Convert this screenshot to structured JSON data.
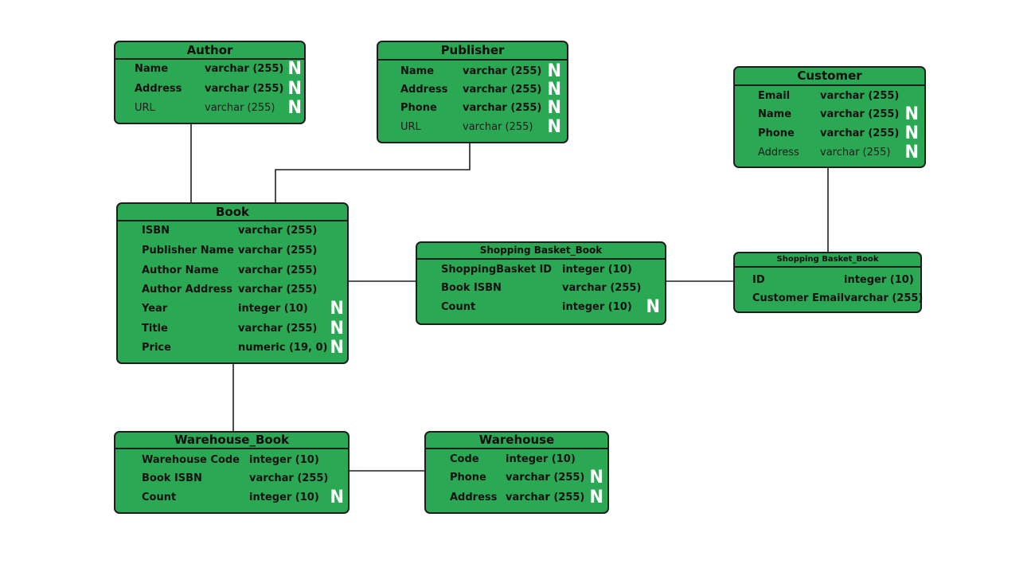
{
  "diagram": {
    "type": "entity-relationship",
    "null_marker": "N",
    "colors": {
      "entity_fill": "#2aa854",
      "border": "#1e1e1e",
      "null_marker": "#ffffff"
    },
    "entities": [
      {
        "id": "author",
        "name": "Author",
        "fields": [
          {
            "name": "Name",
            "type": "varchar (255)",
            "nullable": true,
            "key": true
          },
          {
            "name": "Address",
            "type": "varchar (255)",
            "nullable": true,
            "key": true
          },
          {
            "name": "URL",
            "type": "varchar (255)",
            "nullable": true,
            "key": false
          }
        ]
      },
      {
        "id": "publisher",
        "name": "Publisher",
        "fields": [
          {
            "name": "Name",
            "type": "varchar (255)",
            "nullable": true,
            "key": true
          },
          {
            "name": "Address",
            "type": "varchar (255)",
            "nullable": true,
            "key": true
          },
          {
            "name": "Phone",
            "type": "varchar (255)",
            "nullable": true,
            "key": true
          },
          {
            "name": "URL",
            "type": "varchar (255)",
            "nullable": true,
            "key": false
          }
        ]
      },
      {
        "id": "customer",
        "name": "Customer",
        "fields": [
          {
            "name": "Email",
            "type": "varchar (255)",
            "nullable": false,
            "key": true
          },
          {
            "name": "Name",
            "type": "varchar (255)",
            "nullable": true,
            "key": true
          },
          {
            "name": "Phone",
            "type": "varchar (255)",
            "nullable": true,
            "key": true
          },
          {
            "name": "Address",
            "type": "varchar (255)",
            "nullable": true,
            "key": false
          }
        ]
      },
      {
        "id": "book",
        "name": "Book",
        "fields": [
          {
            "name": "ISBN",
            "type": "varchar (255)",
            "nullable": false,
            "key": true
          },
          {
            "name": "Publisher Name",
            "type": "varchar (255)",
            "nullable": false,
            "key": true
          },
          {
            "name": "Author Name",
            "type": "varchar (255)",
            "nullable": false,
            "key": true
          },
          {
            "name": "Author Address",
            "type": "varchar (255)",
            "nullable": false,
            "key": true
          },
          {
            "name": "Year",
            "type": "integer (10)",
            "nullable": true,
            "key": true
          },
          {
            "name": "Title",
            "type": "varchar (255)",
            "nullable": true,
            "key": true
          },
          {
            "name": "Price",
            "type": "numeric (19, 0)",
            "nullable": true,
            "key": true
          }
        ]
      },
      {
        "id": "shopping_basket_book",
        "name": "Shopping Basket_Book",
        "fields": [
          {
            "name": "ShoppingBasket ID",
            "type": "integer (10)",
            "nullable": false,
            "key": true
          },
          {
            "name": "Book ISBN",
            "type": "varchar (255)",
            "nullable": false,
            "key": true
          },
          {
            "name": "Count",
            "type": "integer (10)",
            "nullable": true,
            "key": true
          }
        ]
      },
      {
        "id": "shopping_basket",
        "name": "Shopping Basket_Book",
        "fields": [
          {
            "name": "ID",
            "type": "integer (10)",
            "nullable": false,
            "key": true
          },
          {
            "name": "Customer Email",
            "type": "varchar (255)",
            "nullable": false,
            "key": true
          }
        ]
      },
      {
        "id": "warehouse_book",
        "name": "Warehouse_Book",
        "fields": [
          {
            "name": "Warehouse Code",
            "type": "integer (10)",
            "nullable": false,
            "key": true
          },
          {
            "name": "Book ISBN",
            "type": "varchar (255)",
            "nullable": false,
            "key": true
          },
          {
            "name": "Count",
            "type": "integer (10)",
            "nullable": true,
            "key": true
          }
        ]
      },
      {
        "id": "warehouse",
        "name": "Warehouse",
        "fields": [
          {
            "name": "Code",
            "type": "integer (10)",
            "nullable": false,
            "key": true
          },
          {
            "name": "Phone",
            "type": "varchar (255)",
            "nullable": true,
            "key": true
          },
          {
            "name": "Address",
            "type": "varchar (255)",
            "nullable": true,
            "key": true
          }
        ]
      }
    ],
    "relationships": [
      {
        "from": "author",
        "to": "book"
      },
      {
        "from": "publisher",
        "to": "book"
      },
      {
        "from": "book",
        "to": "shopping_basket_book"
      },
      {
        "from": "shopping_basket_book",
        "to": "shopping_basket"
      },
      {
        "from": "customer",
        "to": "shopping_basket"
      },
      {
        "from": "book",
        "to": "warehouse_book"
      },
      {
        "from": "warehouse_book",
        "to": "warehouse"
      }
    ]
  }
}
